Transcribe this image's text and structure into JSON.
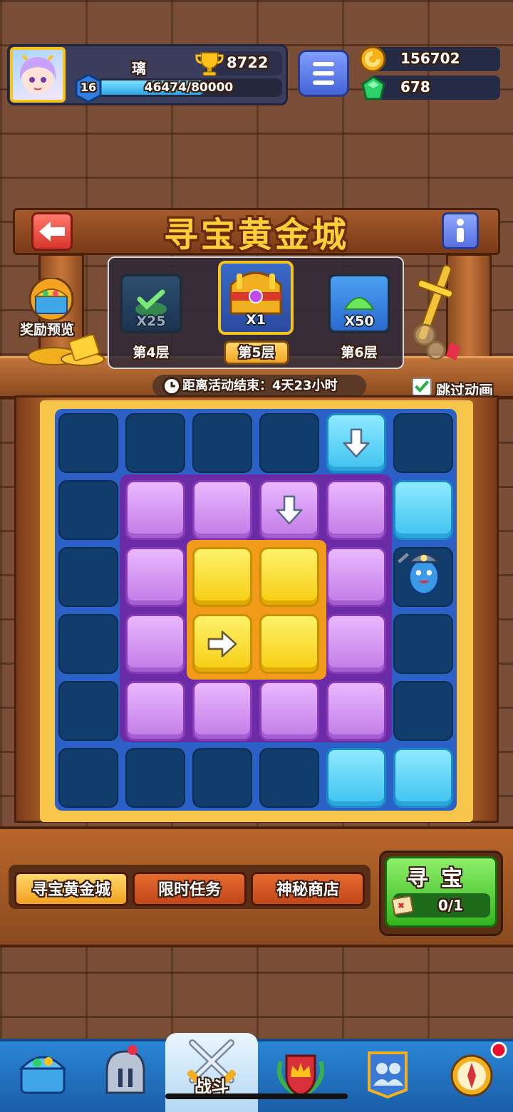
{
  "player": {
    "name": "璃",
    "trophies": "8722",
    "level": "16",
    "xp": "46474/80000",
    "xp_fraction": 0.58
  },
  "resources": {
    "coins": "156702",
    "gems": "678"
  },
  "event": {
    "title": "寻宝黄金城",
    "reward_preview": "奖励预览",
    "floors": [
      {
        "label": "第4层",
        "count": "X25",
        "state": "completed"
      },
      {
        "label": "第5层",
        "count": "X1",
        "state": "current"
      },
      {
        "label": "第6层",
        "count": "X50",
        "state": "locked"
      }
    ],
    "timer": "距离活动结束：4天23小时",
    "skip_animation": "跳过动画"
  },
  "board": {
    "rows": 6,
    "cols": 6,
    "cells": [
      [
        "dark",
        "dark",
        "dark",
        "dark",
        "ice-down",
        "dark"
      ],
      [
        "dark",
        "pur",
        "pur",
        "pur-down",
        "pur",
        "ice"
      ],
      [
        "dark",
        "pur",
        "gold",
        "gold",
        "pur",
        "player"
      ],
      [
        "dark",
        "pur",
        "gold-right",
        "gold",
        "pur",
        "dark"
      ],
      [
        "dark",
        "pur",
        "pur",
        "pur",
        "pur",
        "dark"
      ],
      [
        "dark",
        "dark",
        "dark",
        "dark",
        "ice",
        "ice"
      ]
    ]
  },
  "tabs": [
    "寻宝黄金城",
    "限时任务",
    "神秘商店"
  ],
  "hunt": {
    "label": "寻宝",
    "progress": "0/1"
  },
  "nav": {
    "battle": "战斗"
  },
  "colors": {
    "gold": "#ffcf3a",
    "purple": "#c17ae6",
    "ice": "#3ec2f0",
    "grid": "#2b61c7",
    "green": "#34b41e"
  }
}
